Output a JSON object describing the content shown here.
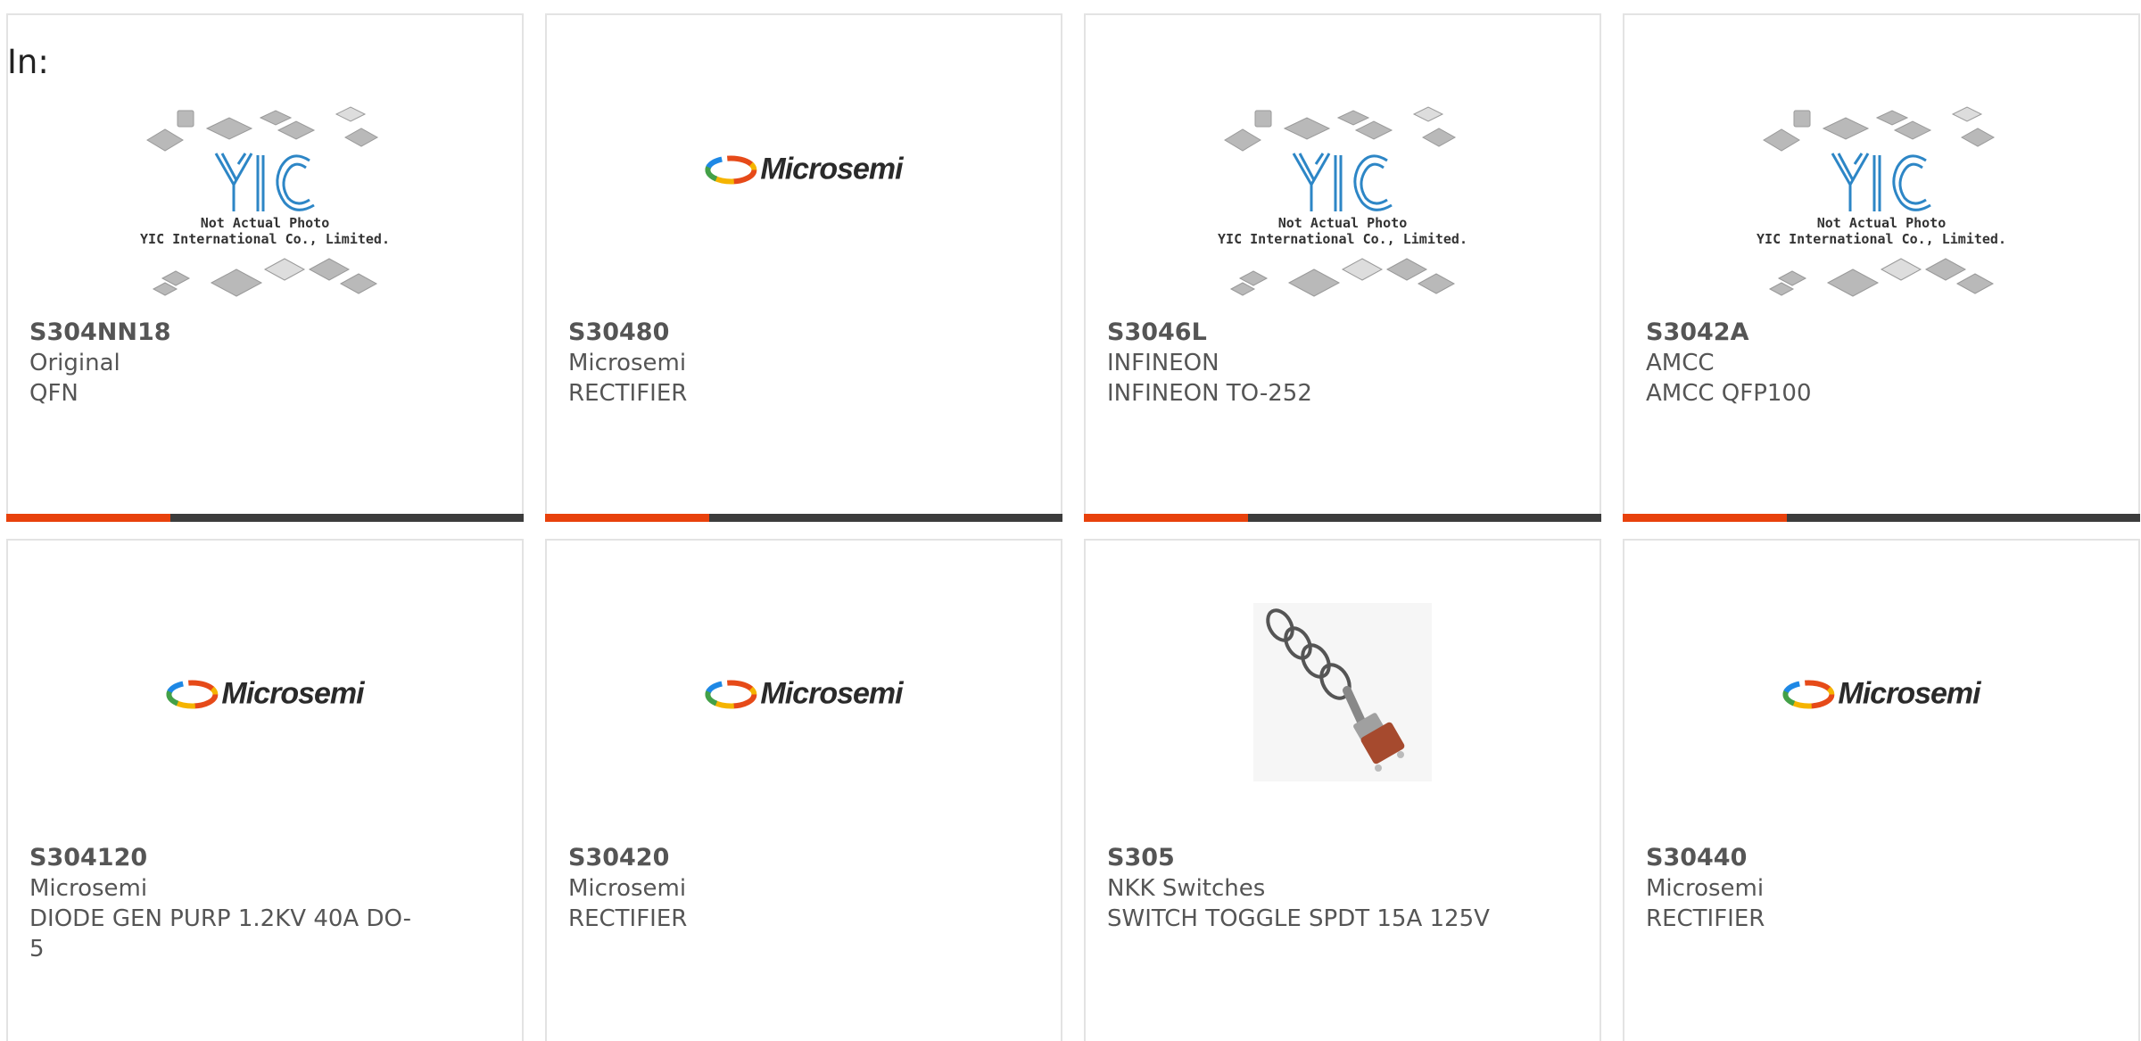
{
  "header": {
    "in_label": "In:"
  },
  "icons": {
    "microsemi_logo": "microsemi-logo",
    "yic_placeholder": "yic-placeholder",
    "toggle_switch_photo": "toggle-switch-photo"
  },
  "colors": {
    "accent": "#e8410c",
    "bar": "#3c3c3c",
    "text": "#555555",
    "border": "#e3e3e3"
  },
  "placeholder": {
    "logo_text": "YIC",
    "caption_line1": "Not Actual Photo",
    "caption_line2": "YIC International Co., Limited."
  },
  "microsemi": {
    "brand": "Microsemi"
  },
  "products": [
    {
      "part": "S304NN18",
      "maker": "Original",
      "desc": "QFN",
      "image": "yic-placeholder"
    },
    {
      "part": "S30480",
      "maker": "Microsemi",
      "desc": "RECTIFIER",
      "image": "microsemi-logo"
    },
    {
      "part": "S3046L",
      "maker": "INFINEON",
      "desc": "INFINEON TO-252",
      "image": "yic-placeholder"
    },
    {
      "part": "S3042A",
      "maker": "AMCC",
      "desc": "AMCC QFP100",
      "image": "yic-placeholder"
    },
    {
      "part": "S304120",
      "maker": "Microsemi",
      "desc": "DIODE GEN PURP 1.2KV 40A DO-5",
      "image": "microsemi-logo"
    },
    {
      "part": "S30420",
      "maker": "Microsemi",
      "desc": "RECTIFIER",
      "image": "microsemi-logo"
    },
    {
      "part": "S305",
      "maker": "NKK Switches",
      "desc": "SWITCH TOGGLE SPDT 15A 125V",
      "image": "toggle-switch-photo"
    },
    {
      "part": "S30440",
      "maker": "Microsemi",
      "desc": "RECTIFIER",
      "image": "microsemi-logo"
    }
  ]
}
